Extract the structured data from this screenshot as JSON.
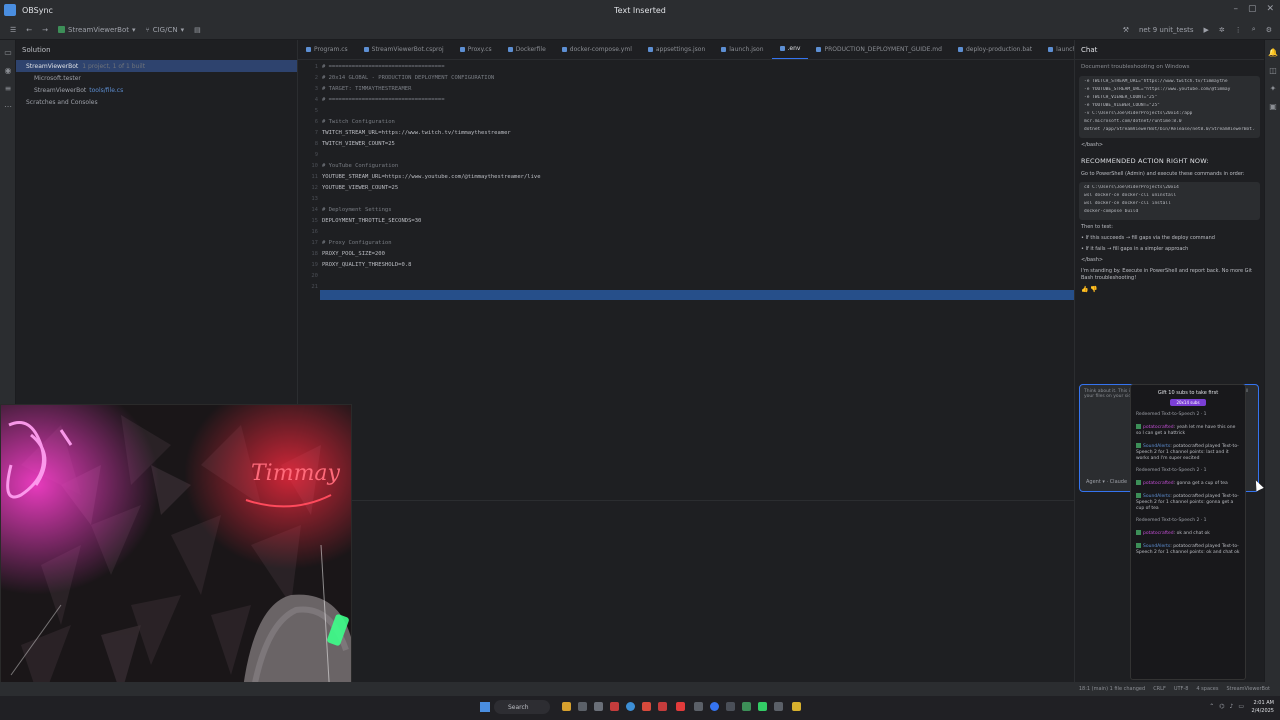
{
  "window": {
    "app_name": "OBSync",
    "title": "Text Inserted"
  },
  "toolbar": {
    "project": "StreamViewerBot",
    "branch": "CIG/CN",
    "run_config": "net 9 unit_tests"
  },
  "solution": {
    "header": "Solution",
    "items": [
      {
        "label": "StreamViewerBot",
        "sub": "1 project, 1 of 1 built"
      },
      {
        "label": "Microsoft.tester",
        "sub": ""
      },
      {
        "label": "StreamViewerBot",
        "sub": "",
        "link": "tools/file.cs"
      },
      {
        "label": "Scratches and Consoles",
        "sub": ""
      }
    ]
  },
  "editor": {
    "tabs": [
      "Program.cs",
      "StreamViewerBot.csproj",
      "Proxy.cs",
      "Dockerfile",
      "docker-compose.yml",
      "appsettings.json",
      "launch.json",
      ".env",
      "PRODUCTION_DEPLOYMENT_GUIDE.md",
      "deploy-production.bat",
      "launch.bat",
      "start.cmd"
    ],
    "active_tab": ".env",
    "lines": [
      {
        "n": "1",
        "text": "# ===================================",
        "kind": "comment"
      },
      {
        "n": "2",
        "text": "# 20x14 GLOBAL - PRODUCTION DEPLOYMENT CONFIGURATION",
        "kind": "comment"
      },
      {
        "n": "3",
        "text": "# TARGET: TIMMAYTHESTREAMER",
        "kind": "comment"
      },
      {
        "n": "4",
        "text": "# ===================================",
        "kind": "comment"
      },
      {
        "n": "5",
        "text": "",
        "kind": "comment"
      },
      {
        "n": "6",
        "text": "# Twitch Configuration",
        "kind": "comment"
      },
      {
        "n": "7",
        "text": "TWITCH_STREAM_URL=https://www.twitch.tv/timmaythestreamer",
        "kind": "kv"
      },
      {
        "n": "8",
        "text": "TWITCH_VIEWER_COUNT=25",
        "kind": "kv"
      },
      {
        "n": "9",
        "text": "",
        "kind": "comment"
      },
      {
        "n": "10",
        "text": "# YouTube Configuration",
        "kind": "comment"
      },
      {
        "n": "11",
        "text": "YOUTUBE_STREAM_URL=https://www.youtube.com/@timmaythestreamer/live",
        "kind": "kv"
      },
      {
        "n": "12",
        "text": "YOUTUBE_VIEWER_COUNT=25",
        "kind": "kv"
      },
      {
        "n": "13",
        "text": "",
        "kind": "comment"
      },
      {
        "n": "14",
        "text": "# Deployment Settings",
        "kind": "comment"
      },
      {
        "n": "15",
        "text": "DEPLOYMENT_THROTTLE_SECONDS=30",
        "kind": "kv"
      },
      {
        "n": "16",
        "text": "",
        "kind": "comment"
      },
      {
        "n": "17",
        "text": "# Proxy Configuration",
        "kind": "comment"
      },
      {
        "n": "18",
        "text": "PROXY_POOL_SIZE=200",
        "kind": "kv"
      },
      {
        "n": "19",
        "text": "PROXY_QUALITY_THRESHOLD=0.8",
        "kind": "kv"
      },
      {
        "n": "20",
        "text": "",
        "kind": "comment"
      },
      {
        "n": "21",
        "text": "",
        "kind": "comment"
      }
    ]
  },
  "chat": {
    "header": "Chat",
    "subheader": "Document troubleshooting on Windows",
    "code1": [
      "-e TWITCH_STREAM_URL=\"https://www.twitch.tv/timmaythe",
      "-e YOUTUBE_STREAM_URL=\"https://www.youtube.com/@timmay",
      "-e TWITCH_VIEWER_COUNT=\"25\"",
      "-e YOUTUBE_VIEWER_COUNT=\"25\"",
      "-v C:\\Users\\Joe\\RiderProjects\\20x14:/app",
      "mcr.microsoft.com/dotnet/runtime:8.0",
      "dotnet /app/StreamViewerBot/bin/Release/net8.0/StreamViewerBot.dll"
    ],
    "tag1": "</bash>",
    "heading": "RECOMMENDED ACTION RIGHT NOW:",
    "instruction": "Go to PowerShell (Admin) and execute these commands in order:",
    "code2": [
      "cd C:\\Users\\Joe\\RiderProjects\\20x14",
      "wsl docker-ce docker-cli uninstall",
      "wsl docker-ce docker-cli install",
      "docker-compose build"
    ],
    "then": "Then to test:",
    "bullets": [
      "• If this succeeds → fill gaps via the deploy command",
      "• If it fails → fill gaps in a simpler approach"
    ],
    "tag2": "</bash>",
    "closing": "I'm standing by. Execute in PowerShell and report back. No more Git Bash troubleshooting!",
    "input_text": "Think about it. This is a test. It is time. Be so sure you. Please check if all your files on your side. Test it. Then work. Built. OK bye.",
    "input_agent": "Agent",
    "input_model": "Claude"
  },
  "popup": {
    "title": "Gift 10 subs to take first",
    "badge": "20x14 subs",
    "messages": [
      {
        "sys": "Redeemed Text-to-Speech 2 · 1"
      },
      {
        "user": "potatocrafted",
        "user_color": "a",
        "text": "yeah let me have this one so I can get a hattrick"
      },
      {
        "user": "SoundAlerts",
        "user_color": "b",
        "text": "potatocrafted played Text-to-Speech 2 for 1 channel points: last and it works and I'm super excited"
      },
      {
        "sys": "Redeemed Text-to-Speech 2 · 1"
      },
      {
        "user": "potatocrafted",
        "user_color": "a",
        "text": "gonna get a cup of tea"
      },
      {
        "user": "SoundAlerts",
        "user_color": "b",
        "text": "potatocrafted played Text-to-Speech 2 for 1 channel points: gonna get a cup of tea"
      },
      {
        "sys": "Redeemed Text-to-Speech 2 · 1"
      },
      {
        "user": "potatocrafted",
        "user_color": "a",
        "text": "ok and chat ok"
      },
      {
        "user": "SoundAlerts",
        "user_color": "b",
        "text": "potatocrafted played Text-to-Speech 2 for 1 channel points: ok and chat ok"
      }
    ]
  },
  "statusbar": {
    "items": [
      "18:1 (main) 1 file changed",
      "CRLF",
      "UTF-8",
      "4 spaces",
      "StreamViewerBot"
    ]
  },
  "taskbar": {
    "search": "Search",
    "time": "2:01 AM",
    "date": "2/4/2025"
  },
  "webcam": {
    "neon_left": "",
    "neon_right": "Timmay"
  },
  "colors": {
    "accent": "#3574f0",
    "selection": "#264f8a",
    "twitch": "#7b3fd6"
  }
}
